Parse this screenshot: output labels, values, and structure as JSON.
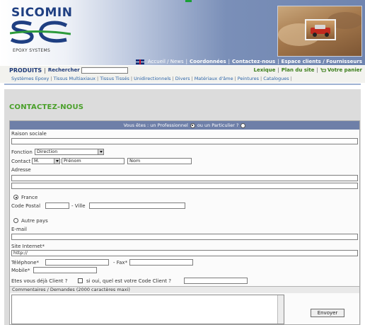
{
  "brand": {
    "name": "SICOMIN",
    "tagline": "EPOXY SYSTEMS"
  },
  "topnav": [
    "Accueil / News",
    "Coordonnées",
    "Contactez-nous",
    "Espace clients / Fournisseurs"
  ],
  "productbar": {
    "products": "PRODUITS",
    "search_label": "Rechercher",
    "search_value": "",
    "links": [
      "Lexique",
      "Plan du site",
      "Votre panier"
    ]
  },
  "categories": [
    "Systèmes Epoxy",
    "Tissus Multiaxiaux",
    "Tissus Tissés",
    "Unidirectionnels",
    "Divers",
    "Matériaux d'âme",
    "Peintures",
    "Catalogues"
  ],
  "page": {
    "title": "CONTACTEZ-NOUS"
  },
  "form": {
    "type_question": "Vous êtes : un Professionnel",
    "type_or": "ou un Particulier ?",
    "raison_sociale": "Raison sociale",
    "fonction_label": "Fonction",
    "fonction_value": "Direction",
    "contact_label": "Contact",
    "civility_value": "M.",
    "prenom_value": "Prénom",
    "nom_value": "Nom",
    "adresse": "Adresse",
    "country_france": "France",
    "code_postal": "Code Postal",
    "ville": "- Ville",
    "autre_pays": "Autre pays",
    "email": "E-mail",
    "site_internet": "Site Internet*",
    "site_value": "http://",
    "telephone": "Téléphone*",
    "fax": "- Fax*",
    "mobile": "Mobile*",
    "deja_client": "Etes vous déjà Client ?",
    "code_client": "si oui, quel est votre Code Client ?",
    "comments": "Commentaires / Demandes (2000 caractères maxi)",
    "send": "Envoyer"
  },
  "colors": {
    "header_blue": "#6f84af",
    "title_green": "#4aa02a",
    "form_header": "#6e7fa8"
  }
}
